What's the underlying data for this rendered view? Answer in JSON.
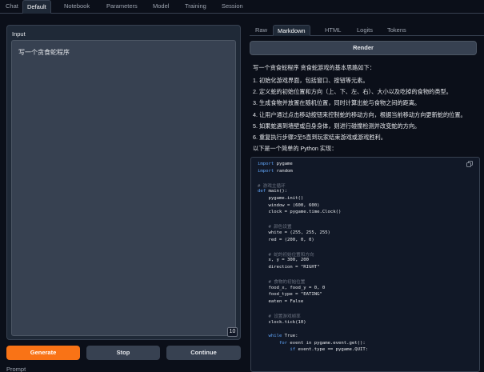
{
  "top_tabs": [
    {
      "label": "Chat",
      "active": false
    },
    {
      "label": "Default",
      "active": true
    },
    {
      "label": "Notebook",
      "active": false
    },
    {
      "label": "Parameters",
      "active": false
    },
    {
      "label": "Model",
      "active": false
    },
    {
      "label": "Training",
      "active": false
    },
    {
      "label": "Session",
      "active": false
    }
  ],
  "input": {
    "label": "Input",
    "value": "写一个贪食蛇程序",
    "token_count": "10"
  },
  "buttons": {
    "generate": "Generate",
    "stop": "Stop",
    "continue": "Continue"
  },
  "prompt_label": "Prompt",
  "output_tabs": [
    {
      "label": "Raw",
      "active": false
    },
    {
      "label": "Markdown",
      "active": true
    },
    {
      "label": "HTML",
      "active": false
    },
    {
      "label": "Logits",
      "active": false
    },
    {
      "label": "Tokens",
      "active": false
    }
  ],
  "render_label": "Render",
  "markdown_lines": [
    "写一个贪食蛇程序 贪食蛇游戏的基本思路如下：",
    "1. 初始化游戏界面，包括窗口、按钮等元素。",
    "2. 定义蛇的初始位置和方向（上、下、左、右）、大小以及吃掉的食物的类型。",
    "3. 生成食物并放置在随机位置，同时计算出蛇与食物之间的距离。",
    "4. 让用户通过点击移动按钮来控制蛇的移动方向，根据当前移动方向更新蛇的位置。",
    "5. 如果蛇遇到墙壁或自身身体，则进行碰撞检测并改变蛇的方向。",
    "6. 重复执行步骤2至5直到玩家结束游戏或游戏胜利。",
    "以下是一个简单的 Python 实现："
  ],
  "code_lines": [
    {
      "k": "import",
      "t": " pygame",
      "type": "kw"
    },
    {
      "k": "import",
      "t": " random",
      "type": "kw"
    },
    {
      "k": "",
      "t": "",
      "type": "blank"
    },
    {
      "k": "",
      "t": "# 游戏主循环",
      "type": "cm"
    },
    {
      "k": "def",
      "t": " main():",
      "type": "kw"
    },
    {
      "k": "",
      "t": "    pygame.init()",
      "type": "txt"
    },
    {
      "k": "",
      "t": "    window = (600, 600)",
      "type": "txt"
    },
    {
      "k": "",
      "t": "    clock = pygame.time.Clock()",
      "type": "txt"
    },
    {
      "k": "",
      "t": "",
      "type": "blank"
    },
    {
      "k": "",
      "t": "    # 颜色设置",
      "type": "cm"
    },
    {
      "k": "",
      "t": "    white = (255, 255, 255)",
      "type": "txt"
    },
    {
      "k": "",
      "t": "    red = (200, 0, 0)",
      "type": "txt"
    },
    {
      "k": "",
      "t": "",
      "type": "blank"
    },
    {
      "k": "",
      "t": "    # 蛇的初始位置和方向",
      "type": "cm"
    },
    {
      "k": "",
      "t": "    x, y = 300, 200",
      "type": "txt"
    },
    {
      "k": "",
      "t": "    direction = \"RIGHT\"",
      "type": "txt"
    },
    {
      "k": "",
      "t": "",
      "type": "blank"
    },
    {
      "k": "",
      "t": "    # 食物的初始位置",
      "type": "cm"
    },
    {
      "k": "",
      "t": "    food_x, food_y = 0, 0",
      "type": "txt"
    },
    {
      "k": "",
      "t": "    food_type = \"EATING\"",
      "type": "txt"
    },
    {
      "k": "",
      "t": "    eaten = False",
      "type": "txt"
    },
    {
      "k": "",
      "t": "",
      "type": "blank"
    },
    {
      "k": "",
      "t": "    # 设置游戏帧率",
      "type": "cm"
    },
    {
      "k": "",
      "t": "    clock.tick(10)",
      "type": "txt"
    },
    {
      "k": "",
      "t": "",
      "type": "blank"
    },
    {
      "k": "    while",
      "t": " True:",
      "type": "kw"
    },
    {
      "k": "        for",
      "t": " event in pygame.event.get():",
      "type": "kw"
    },
    {
      "k": "            if",
      "t": " event.type == pygame.QUIT:",
      "type": "kw"
    }
  ],
  "colors": {
    "accent": "#f97316",
    "background": "#0b0f19",
    "panel": "#1f2937"
  },
  "icons": {
    "copy": "copy-icon"
  }
}
